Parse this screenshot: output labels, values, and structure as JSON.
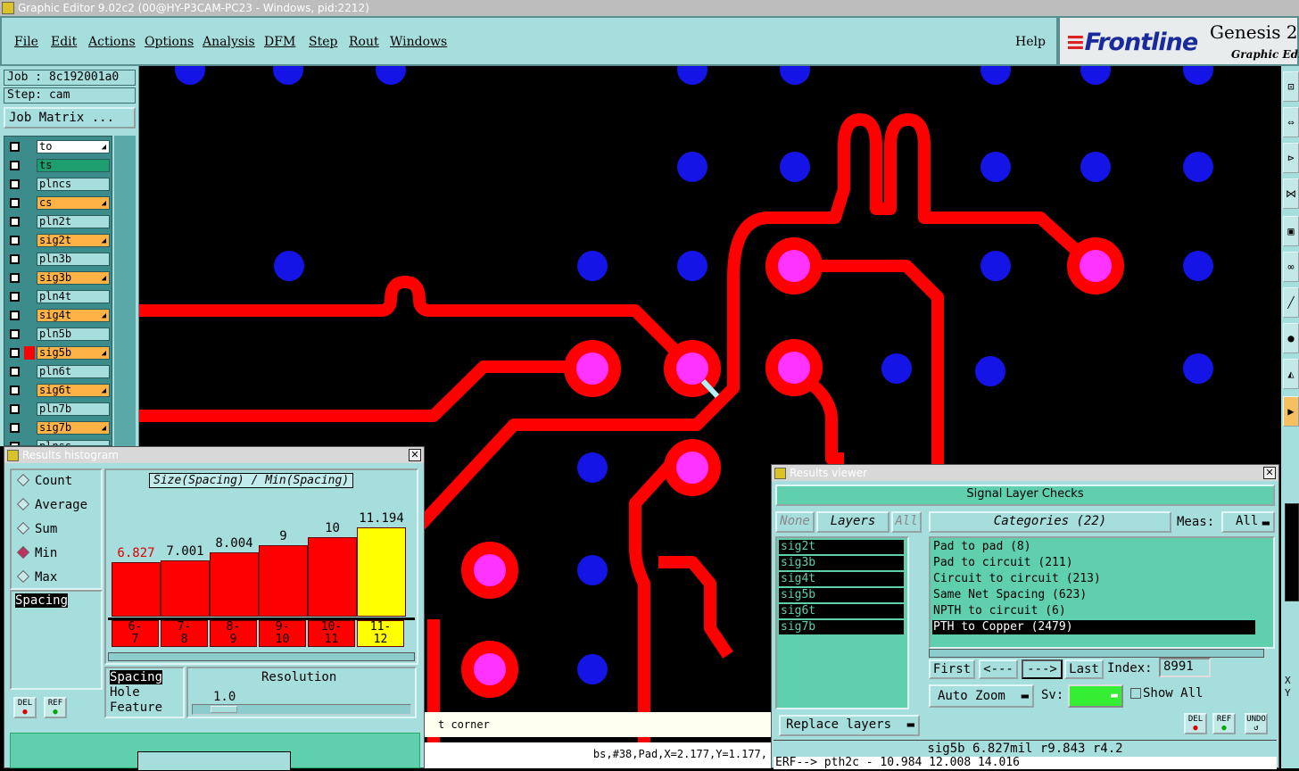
{
  "window": {
    "title": "Graphic Editor 9.02c2 (00@HY-P3CAM-PC23 - Windows, pid:2212)"
  },
  "menu": {
    "items": [
      "File",
      "Edit",
      "Actions",
      "Options",
      "Analysis",
      "DFM",
      "Step",
      "Rout",
      "Windows"
    ],
    "help": "Help"
  },
  "brand": {
    "logo": "Frontline",
    "product": "Genesis 2",
    "subtitle": "Graphic Edit"
  },
  "job": {
    "job": "Job : 8c192001a0",
    "step": "Step: cam",
    "matrix_btn": "Job Matrix ..."
  },
  "layers": [
    {
      "name": "to",
      "color": "#ffffff",
      "arrow": true
    },
    {
      "name": "ts",
      "color": "#1e9e6e",
      "arrow": false
    },
    {
      "name": "plncs",
      "color": "#a6dede",
      "arrow": false
    },
    {
      "name": "cs",
      "color": "#ffb347",
      "arrow": true
    },
    {
      "name": "pln2t",
      "color": "#a6dede",
      "arrow": false
    },
    {
      "name": "sig2t",
      "color": "#ffb347",
      "arrow": true
    },
    {
      "name": "pln3b",
      "color": "#a6dede",
      "arrow": false
    },
    {
      "name": "sig3b",
      "color": "#ffb347",
      "arrow": true
    },
    {
      "name": "pln4t",
      "color": "#a6dede",
      "arrow": false
    },
    {
      "name": "sig4t",
      "color": "#ffb347",
      "arrow": true
    },
    {
      "name": "pln5b",
      "color": "#a6dede",
      "arrow": false
    },
    {
      "name": "sig5b",
      "color": "#ffb347",
      "arrow": true
    },
    {
      "name": "pln6t",
      "color": "#a6dede",
      "arrow": false
    },
    {
      "name": "sig6t",
      "color": "#ffb347",
      "arrow": true
    },
    {
      "name": "pln7b",
      "color": "#a6dede",
      "arrow": false
    },
    {
      "name": "sig7b",
      "color": "#ffb347",
      "arrow": true
    },
    {
      "name": "plnss",
      "color": "#a6dede",
      "arrow": false
    }
  ],
  "histogram": {
    "title": "Results histogram",
    "modes": [
      "Count",
      "Average",
      "Sum",
      "Min",
      "Max"
    ],
    "selected_mode": "Min",
    "field_value": "Spacing",
    "chart_title": "Size(Spacing) / Min(Spacing)",
    "attrs": [
      "Spacing",
      "Hole",
      "Feature"
    ],
    "resolution_label": "Resolution",
    "resolution_value": "1.0",
    "del_label": "DEL",
    "ref_label": "REF"
  },
  "chart_data": {
    "type": "bar",
    "title": "Size(Spacing) / Min(Spacing)",
    "categories": [
      "6-7",
      "7-8",
      "8-9",
      "9-10",
      "10-11",
      "11-12"
    ],
    "values": [
      6.827,
      7.001,
      8.004,
      9,
      10,
      11.194
    ],
    "value_labels": [
      "6.827",
      "7.001",
      "8.004",
      "9",
      "10",
      "11.194"
    ],
    "bin_top": [
      "6-",
      "7-",
      "8-",
      "9-",
      "10-",
      "11-"
    ],
    "bin_bottom": [
      "7",
      "8",
      "9",
      "10",
      "11",
      "12"
    ],
    "highlight_index": 5,
    "bar_color": "#ff0000",
    "highlight_color": "#ffff00",
    "ylim": [
      0,
      11.194
    ]
  },
  "results": {
    "title": "Results viewer",
    "header": "Signal Layer Checks",
    "none_btn": "None",
    "layers_label": "Layers",
    "all_btn": "All",
    "categories_label": "Categories (22)",
    "meas_label": "Meas:",
    "meas_value": "All",
    "layers": [
      "sig2t",
      "sig3b",
      "sig4t",
      "sig5b",
      "sig6t",
      "sig7b"
    ],
    "categories": [
      "Pad to pad (8)",
      "Pad to circuit (211)",
      "Circuit to circuit (213)",
      "Same Net Spacing (623)",
      "NPTH to circuit (6)",
      "PTH to Copper (2479)"
    ],
    "selected_category": 5,
    "nav": {
      "first": "First",
      "prev": "<---",
      "next": "--->",
      "last": "Last",
      "index_label": "Index:",
      "index_value": "8991"
    },
    "auto_zoom": "Auto Zoom",
    "sv_label": "Sv:",
    "show_all": "Show All",
    "replace_layers": "Replace layers",
    "del_label": "DEL",
    "ref_label": "REF",
    "undo_label": "UNDO",
    "status1": "sig5b 6.827mil  r9.843  r4.2",
    "status2": "ERF--> pth2c - 10.984 12.008 14.016"
  },
  "statusbar": {
    "hint": "t corner",
    "feature": "bs,#38,Pad,X=2.177,Y=1.177,"
  },
  "colors": {
    "panel": "#a6dede",
    "trace": "#ff0000",
    "via": "#1414e6",
    "pad": "#ff33ff"
  }
}
